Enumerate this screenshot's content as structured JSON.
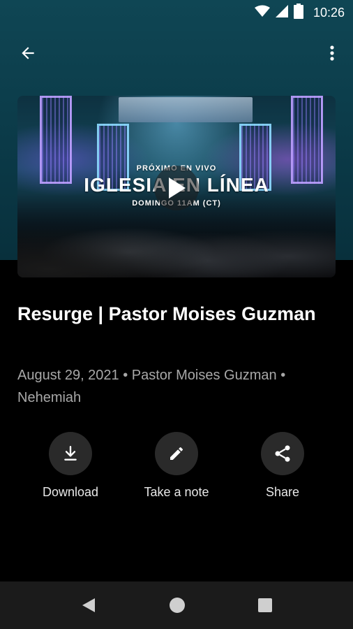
{
  "status_bar": {
    "time": "10:26",
    "icons": [
      "wifi-icon",
      "signal-icon",
      "battery-icon"
    ]
  },
  "app_bar": {
    "back_icon": "arrow-back-icon",
    "more_icon": "more-vert-icon"
  },
  "media": {
    "promo_top": "PRÓXIMO EN VIVO",
    "promo_title": "IGLESIA EN LÍNEA",
    "promo_bottom": "DOMINGO 11AM (CT)",
    "play_icon": "play-icon"
  },
  "sermon": {
    "title": "Resurge | Pastor Moises Guzman",
    "meta": "August 29, 2021 • Pastor Moises Guzman • Nehemiah"
  },
  "actions": [
    {
      "label": "Download",
      "icon": "download-icon"
    },
    {
      "label": "Take a note",
      "icon": "pencil-icon"
    },
    {
      "label": "Share",
      "icon": "share-icon"
    }
  ],
  "nav_bar": {
    "icons": [
      "nav-back-icon",
      "nav-home-icon",
      "nav-recents-icon"
    ]
  },
  "colors": {
    "header_bg": "#0b3a48",
    "page_bg": "#000000",
    "meta_text": "#a8a8a8",
    "action_circle": "#2a2a2a",
    "nav_bg": "#1b1b1b"
  }
}
